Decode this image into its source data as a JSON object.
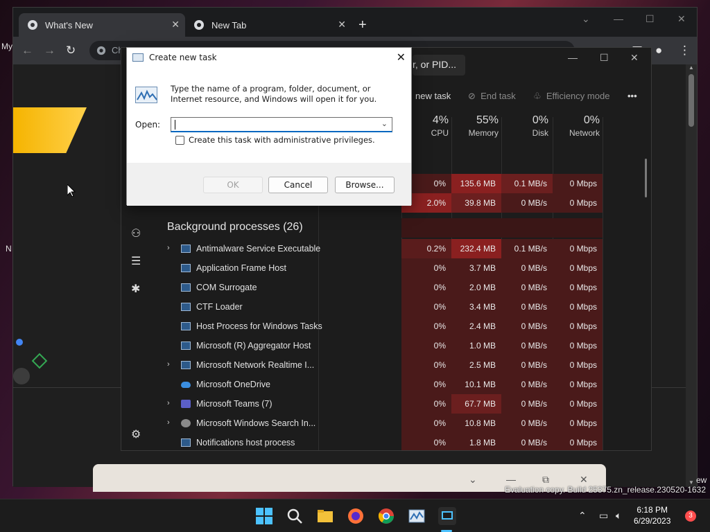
{
  "desktop": {
    "edge_text_top": "My",
    "edge_text_mid": "N",
    "edge_text_right": "ew"
  },
  "chrome": {
    "tabs": [
      {
        "title": "What's New",
        "active": true
      },
      {
        "title": "New Tab",
        "active": false
      }
    ],
    "new_tab_symbol": "+",
    "omnibox_prefix": "Ch"
  },
  "taskmgr": {
    "search_placeholder": "r, or PID...",
    "commands": {
      "run_new_task": "new task",
      "end_task": "End task",
      "efficiency_mode": "Efficiency mode",
      "more": "•••"
    },
    "columns": [
      {
        "pct": "4%",
        "label": "CPU"
      },
      {
        "pct": "55%",
        "label": "Memory"
      },
      {
        "pct": "0%",
        "label": "Disk"
      },
      {
        "pct": "0%",
        "label": "Network"
      }
    ],
    "top_rows": [
      {
        "cpu": "0%",
        "mem": "135.6 MB",
        "disk": "0.1 MB/s",
        "net": "0 Mbps",
        "cpu_heat": "heat1",
        "mem_heat": "heat3",
        "disk_heat": "heat2"
      },
      {
        "cpu": "2.0%",
        "mem": "39.8 MB",
        "disk": "0 MB/s",
        "net": "0 Mbps",
        "cpu_heat": "heat3",
        "mem_heat": "heat2",
        "disk_heat": "heat1"
      }
    ],
    "section_title": "Background processes (26)",
    "processes": [
      {
        "name": "Antimalware Service Executable",
        "expandable": true,
        "icon": "app",
        "cpu": "0.2%",
        "mem": "232.4 MB",
        "disk": "0.1 MB/s",
        "net": "0 Mbps"
      },
      {
        "name": "Application Frame Host",
        "expandable": false,
        "icon": "app",
        "cpu": "0%",
        "mem": "3.7 MB",
        "disk": "0 MB/s",
        "net": "0 Mbps"
      },
      {
        "name": "COM Surrogate",
        "expandable": false,
        "icon": "app",
        "cpu": "0%",
        "mem": "2.0 MB",
        "disk": "0 MB/s",
        "net": "0 Mbps"
      },
      {
        "name": "CTF Loader",
        "expandable": false,
        "icon": "app",
        "cpu": "0%",
        "mem": "3.4 MB",
        "disk": "0 MB/s",
        "net": "0 Mbps"
      },
      {
        "name": "Host Process for Windows Tasks",
        "expandable": false,
        "icon": "app",
        "cpu": "0%",
        "mem": "2.4 MB",
        "disk": "0 MB/s",
        "net": "0 Mbps"
      },
      {
        "name": "Microsoft (R) Aggregator Host",
        "expandable": false,
        "icon": "app",
        "cpu": "0%",
        "mem": "1.0 MB",
        "disk": "0 MB/s",
        "net": "0 Mbps"
      },
      {
        "name": "Microsoft Network Realtime I...",
        "expandable": true,
        "icon": "app",
        "cpu": "0%",
        "mem": "2.5 MB",
        "disk": "0 MB/s",
        "net": "0 Mbps"
      },
      {
        "name": "Microsoft OneDrive",
        "expandable": false,
        "icon": "cloud",
        "cpu": "0%",
        "mem": "10.1 MB",
        "disk": "0 MB/s",
        "net": "0 Mbps"
      },
      {
        "name": "Microsoft Teams (7)",
        "expandable": true,
        "icon": "teams",
        "cpu": "0%",
        "mem": "67.7 MB",
        "disk": "0 MB/s",
        "net": "0 Mbps"
      },
      {
        "name": "Microsoft Windows Search In...",
        "expandable": true,
        "icon": "search",
        "cpu": "0%",
        "mem": "10.8 MB",
        "disk": "0 MB/s",
        "net": "0 Mbps"
      },
      {
        "name": "Notifications host process",
        "expandable": false,
        "icon": "app",
        "cpu": "0%",
        "mem": "1.8 MB",
        "disk": "0 MB/s",
        "net": "0 Mbps"
      }
    ]
  },
  "dialog": {
    "title": "Create new task",
    "description": "Type the name of a program, folder, document, or Internet resource, and Windows will open it for you.",
    "open_label": "Open:",
    "open_value": "",
    "admin_checkbox_label": "Create this task with administrative privileges.",
    "ok_label": "OK",
    "cancel_label": "Cancel",
    "browse_label": "Browse..."
  },
  "watermark": "Evaluation copy. Build 25375.zn_release.230520-1632",
  "taskbar": {
    "time": "6:18 PM",
    "date": "6/29/2023",
    "notification_count": "3"
  },
  "colors": {
    "accent": "#0067c0",
    "heat_low": "#4a1a1a",
    "heat_mid": "#6b1f1f",
    "heat_high": "#8a2020"
  }
}
